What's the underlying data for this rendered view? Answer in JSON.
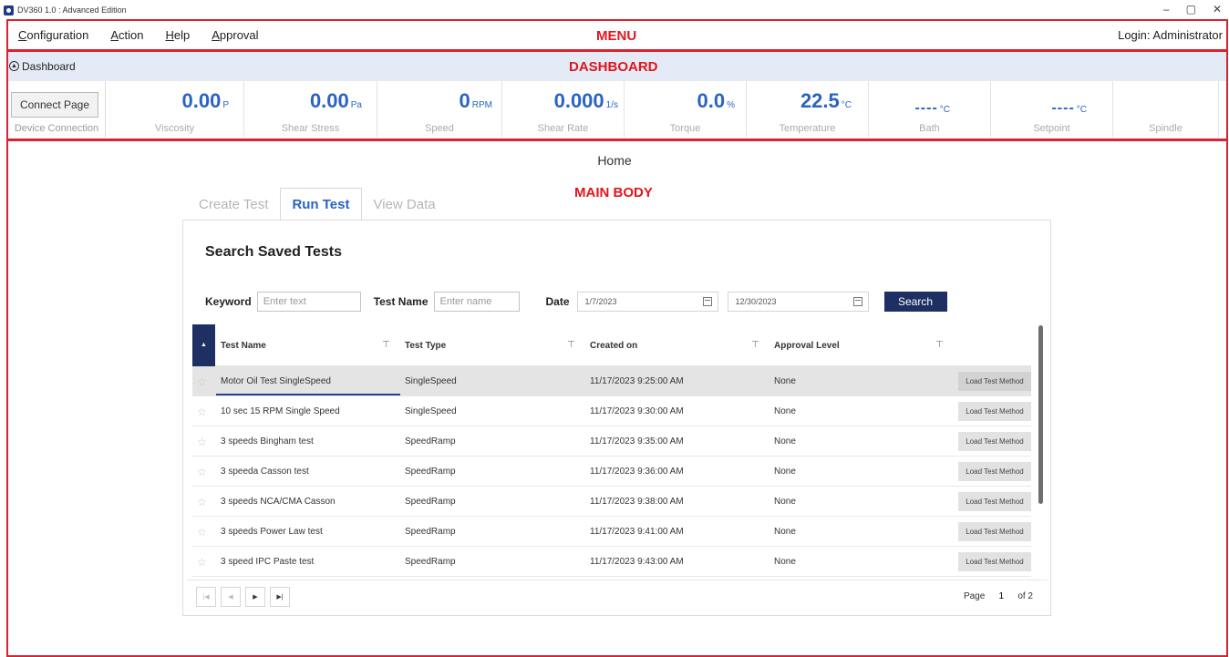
{
  "window": {
    "title": "DV360 1.0    : Advanced Edition",
    "controls": [
      "–",
      "▢",
      "✕"
    ]
  },
  "annotations": {
    "menu": "MENU",
    "dashboard": "DASHBOARD",
    "main_body": "MAIN BODY"
  },
  "menu": {
    "items": [
      {
        "first": "C",
        "rest": "onfiguration"
      },
      {
        "first": "A",
        "rest": "ction"
      },
      {
        "first": "H",
        "rest": "elp"
      },
      {
        "first": "A",
        "rest": "pproval"
      }
    ],
    "login": "Login: Administrator"
  },
  "dashboard": {
    "toggle_label": "Dashboard",
    "connect_button": "Connect Page",
    "connect_caption": "Device Connection",
    "metrics": [
      {
        "value": "0.00",
        "unit": "P",
        "label": "Viscosity"
      },
      {
        "value": "0.00",
        "unit": "Pa",
        "label": "Shear Stress"
      },
      {
        "value": "0",
        "unit": "RPM",
        "label": "Speed"
      },
      {
        "value": "0.000",
        "unit": "1/s",
        "label": "Shear Rate"
      },
      {
        "value": "0.0",
        "unit": "%",
        "label": "Torque"
      },
      {
        "value": "22.5",
        "unit": "°C",
        "label": "Temperature"
      },
      {
        "value": "----",
        "unit": "°C",
        "label": "Bath"
      },
      {
        "value": "----",
        "unit": "°C",
        "label": "Setpoint"
      },
      {
        "value": "",
        "unit": "",
        "label": "Spindle"
      }
    ]
  },
  "main": {
    "home_title": "Home",
    "tabs": [
      {
        "label": "Create Test",
        "active": false
      },
      {
        "label": "Run Test",
        "active": true
      },
      {
        "label": "View Data",
        "active": false
      }
    ],
    "panel_title": "Search Saved Tests",
    "filters": {
      "keyword_label": "Keyword",
      "keyword_placeholder": "Enter text",
      "testname_label": "Test Name",
      "testname_placeholder": "Enter name",
      "date_label": "Date",
      "date_from": "1/7/2023",
      "date_to": "12/30/2023",
      "search_button": "Search"
    },
    "grid": {
      "columns": [
        "Test Name",
        "Test Type",
        "Created on",
        "Approval Level"
      ],
      "load_label": "Load Test Method",
      "rows": [
        {
          "name": "Motor Oil Test SingleSpeed",
          "type": "SingleSpeed",
          "created": "11/17/2023 9:25:00 AM",
          "approval": "None"
        },
        {
          "name": "10 sec 15 RPM Single Speed",
          "type": "SingleSpeed",
          "created": "11/17/2023 9:30:00 AM",
          "approval": "None"
        },
        {
          "name": "3 speeds Bingham test",
          "type": "SpeedRamp",
          "created": "11/17/2023 9:35:00 AM",
          "approval": "None"
        },
        {
          "name": "3 speeda Casson test",
          "type": "SpeedRamp",
          "created": "11/17/2023 9:36:00 AM",
          "approval": "None"
        },
        {
          "name": "3 speeds NCA/CMA Casson",
          "type": "SpeedRamp",
          "created": "11/17/2023 9:38:00 AM",
          "approval": "None"
        },
        {
          "name": "3 speeds Power Law test",
          "type": "SpeedRamp",
          "created": "11/17/2023 9:41:00 AM",
          "approval": "None"
        },
        {
          "name": "3 speed IPC Paste test",
          "type": "SpeedRamp",
          "created": "11/17/2023 9:43:00 AM",
          "approval": "None"
        }
      ]
    },
    "pager": {
      "page_label": "Page",
      "current": "1",
      "of_label": "of 2"
    }
  },
  "colors": {
    "accent": "#2a63c5",
    "navy": "#1e2f63",
    "annotation_red": "#e1151c",
    "dashboard_bg": "#e5ebf6"
  }
}
